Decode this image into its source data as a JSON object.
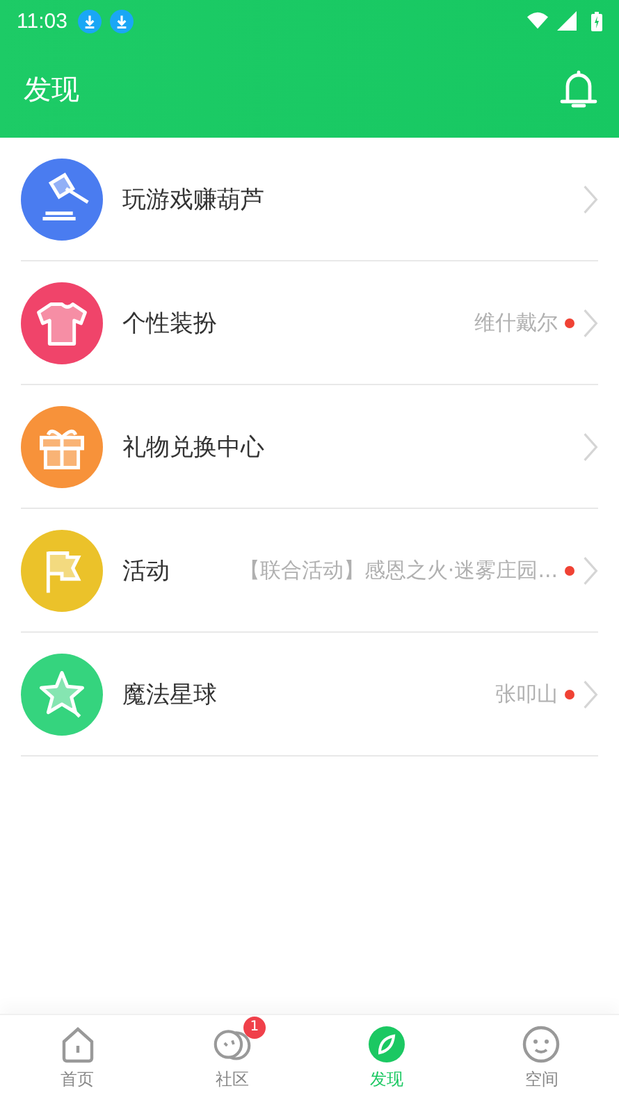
{
  "status_bar": {
    "time": "11:03"
  },
  "header": {
    "title": "发现"
  },
  "items": [
    {
      "kind": "gavel",
      "color": "#4a7cf0",
      "title": "玩游戏赚葫芦",
      "dot": false
    },
    {
      "kind": "shirt",
      "color": "#f0446a",
      "title": "个性装扮",
      "subtitle": "维什戴尔",
      "dot": true
    },
    {
      "kind": "gift",
      "color": "#f7923a",
      "title": "礼物兑换中心",
      "dot": false
    },
    {
      "kind": "flag",
      "color": "#ebc22a",
      "title": "活动",
      "subtitle": "【联合活动】感恩之火·迷雾庄园...",
      "dot": true
    },
    {
      "kind": "star",
      "color": "#35d47e",
      "title": "魔法星球",
      "subtitle": "张叩山",
      "dot": true
    }
  ],
  "tabs": [
    {
      "kind": "home",
      "label": "首页",
      "selected": false
    },
    {
      "kind": "community",
      "label": "社区",
      "selected": false,
      "badge": "1"
    },
    {
      "kind": "discover",
      "label": "发现",
      "selected": true
    },
    {
      "kind": "space",
      "label": "空间",
      "selected": false
    }
  ]
}
